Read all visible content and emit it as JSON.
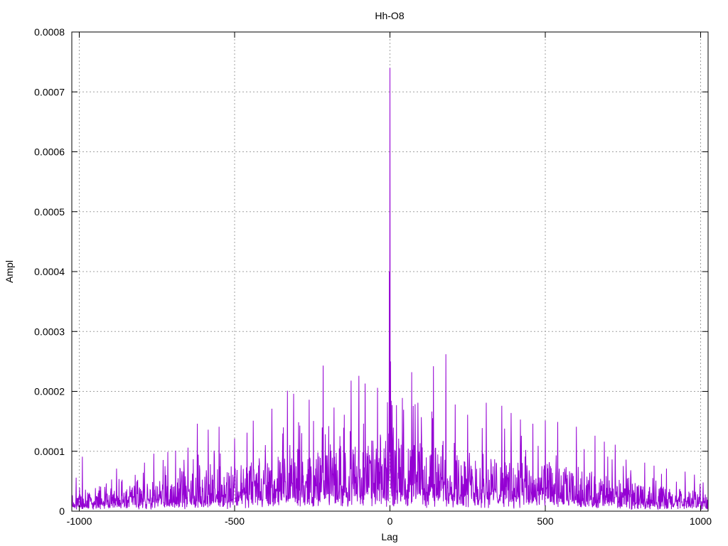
{
  "chart_data": {
    "type": "line",
    "title": "Hh-O8",
    "xlabel": "Lag",
    "ylabel": "Ampl",
    "xlim": [
      -1024,
      1024
    ],
    "ylim": [
      0,
      0.0008
    ],
    "grid": true,
    "xticks": [
      -1000,
      -500,
      0,
      500,
      1000
    ],
    "yticks": [
      0,
      0.0001,
      0.0002,
      0.0003,
      0.0004,
      0.0005,
      0.0006,
      0.0007,
      0.0008
    ],
    "xtick_labels": [
      "-1000",
      "-500",
      "0",
      "500",
      "1000"
    ],
    "ytick_labels": [
      "0",
      "0.0001",
      "0.0002",
      "0.0003",
      "0.0004",
      "0.0005",
      "0.0006",
      "0.0007",
      "0.0008"
    ],
    "series": [
      {
        "color": "#9400d3",
        "envelope_base": [
          [
            -1024,
            1.8e-05
          ],
          [
            -900,
            2.2e-05
          ],
          [
            -800,
            2.8e-05
          ],
          [
            -700,
            3.4e-05
          ],
          [
            -600,
            4e-05
          ],
          [
            -500,
            4.5e-05
          ],
          [
            -400,
            5e-05
          ],
          [
            -300,
            5.5e-05
          ],
          [
            -200,
            6e-05
          ],
          [
            -100,
            6.6e-05
          ],
          [
            0,
            7e-05
          ],
          [
            100,
            6.6e-05
          ],
          [
            200,
            6e-05
          ],
          [
            300,
            5.5e-05
          ],
          [
            400,
            5e-05
          ],
          [
            500,
            4.5e-05
          ],
          [
            600,
            4e-05
          ],
          [
            700,
            3.4e-05
          ],
          [
            800,
            2.8e-05
          ],
          [
            900,
            2.2e-05
          ],
          [
            1024,
            1.8e-05
          ]
        ],
        "peaks": [
          {
            "x": 0,
            "y": 0.00074
          },
          {
            "x": -2,
            "y": 0.0004
          },
          {
            "x": 2,
            "y": 0.00025
          },
          {
            "x": 180,
            "y": 0.000262
          },
          {
            "x": -215,
            "y": 0.000243
          },
          {
            "x": 140,
            "y": 0.000242
          },
          {
            "x": 70,
            "y": 0.000232
          },
          {
            "x": -100,
            "y": 0.000226
          },
          {
            "x": -125,
            "y": 0.000218
          },
          {
            "x": -80,
            "y": 0.000213
          },
          {
            "x": -40,
            "y": 0.000206
          },
          {
            "x": -330,
            "y": 0.000201
          },
          {
            "x": -310,
            "y": 0.000196
          },
          {
            "x": 40,
            "y": 0.000189
          },
          {
            "x": -260,
            "y": 0.000186
          },
          {
            "x": 90,
            "y": 0.000181
          },
          {
            "x": 310,
            "y": 0.000181
          },
          {
            "x": 210,
            "y": 0.000178
          },
          {
            "x": 360,
            "y": 0.000176
          },
          {
            "x": -380,
            "y": 0.000171
          },
          {
            "x": -180,
            "y": 0.000173
          },
          {
            "x": 390,
            "y": 0.000164
          },
          {
            "x": 250,
            "y": 0.000161
          },
          {
            "x": 420,
            "y": 0.000153
          },
          {
            "x": -440,
            "y": 0.000151
          },
          {
            "x": 500,
            "y": 0.000151
          },
          {
            "x": -620,
            "y": 0.000146
          },
          {
            "x": 540,
            "y": 0.000149
          },
          {
            "x": 460,
            "y": 0.000146
          },
          {
            "x": -550,
            "y": 0.000141
          },
          {
            "x": -585,
            "y": 0.000136
          },
          {
            "x": 600,
            "y": 0.000141
          },
          {
            "x": -460,
            "y": 0.000131
          },
          {
            "x": -500,
            "y": 0.000121
          },
          {
            "x": 660,
            "y": 0.000126
          },
          {
            "x": 690,
            "y": 0.000116
          },
          {
            "x": 725,
            "y": 0.000111
          },
          {
            "x": -650,
            "y": 0.000106
          },
          {
            "x": -690,
            "y": 0.000101
          },
          {
            "x": -715,
            "y": 9.9e-05
          },
          {
            "x": -760,
            "y": 9.6e-05
          },
          {
            "x": -790,
            "y": 8.1e-05
          },
          {
            "x": 760,
            "y": 8.6e-05
          },
          {
            "x": 820,
            "y": 8.1e-05
          },
          {
            "x": 850,
            "y": 7.6e-05
          },
          {
            "x": -990,
            "y": 9.1e-05
          },
          {
            "x": -880,
            "y": 7.1e-05
          },
          {
            "x": 890,
            "y": 7.1e-05
          },
          {
            "x": 950,
            "y": 6.6e-05
          },
          {
            "x": 980,
            "y": 6.1e-05
          },
          {
            "x": -1010,
            "y": 5.6e-05
          }
        ]
      }
    ]
  }
}
